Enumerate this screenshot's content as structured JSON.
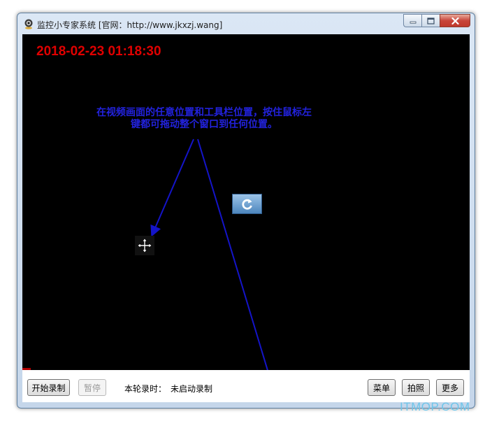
{
  "window": {
    "title": "监控小专家系统 [官网：http://www.jkxzj.wang]",
    "icon": "webcam-icon"
  },
  "video": {
    "timestamp": "2018-02-23 01:18:30",
    "hint_line1": "在视频画面的任意位置和工具栏位置，按住鼠标左",
    "hint_line2": "键都可拖动整个窗口到任何位置。",
    "icons": [
      "move-cursor-icon",
      "refresh-icon"
    ]
  },
  "toolbar": {
    "start_record_label": "开始录制",
    "pause_label": "暂停",
    "round_time_label": "本轮录时：",
    "record_status": "未启动录制",
    "menu_label": "菜单",
    "snapshot_label": "拍照",
    "more_label": "更多"
  },
  "watermark": "ITMOP.COM",
  "colors": {
    "timestamp": "#e00000",
    "hint_text": "#2222dd",
    "video_bg": "#000000",
    "watermark": "#6fc6ea"
  }
}
